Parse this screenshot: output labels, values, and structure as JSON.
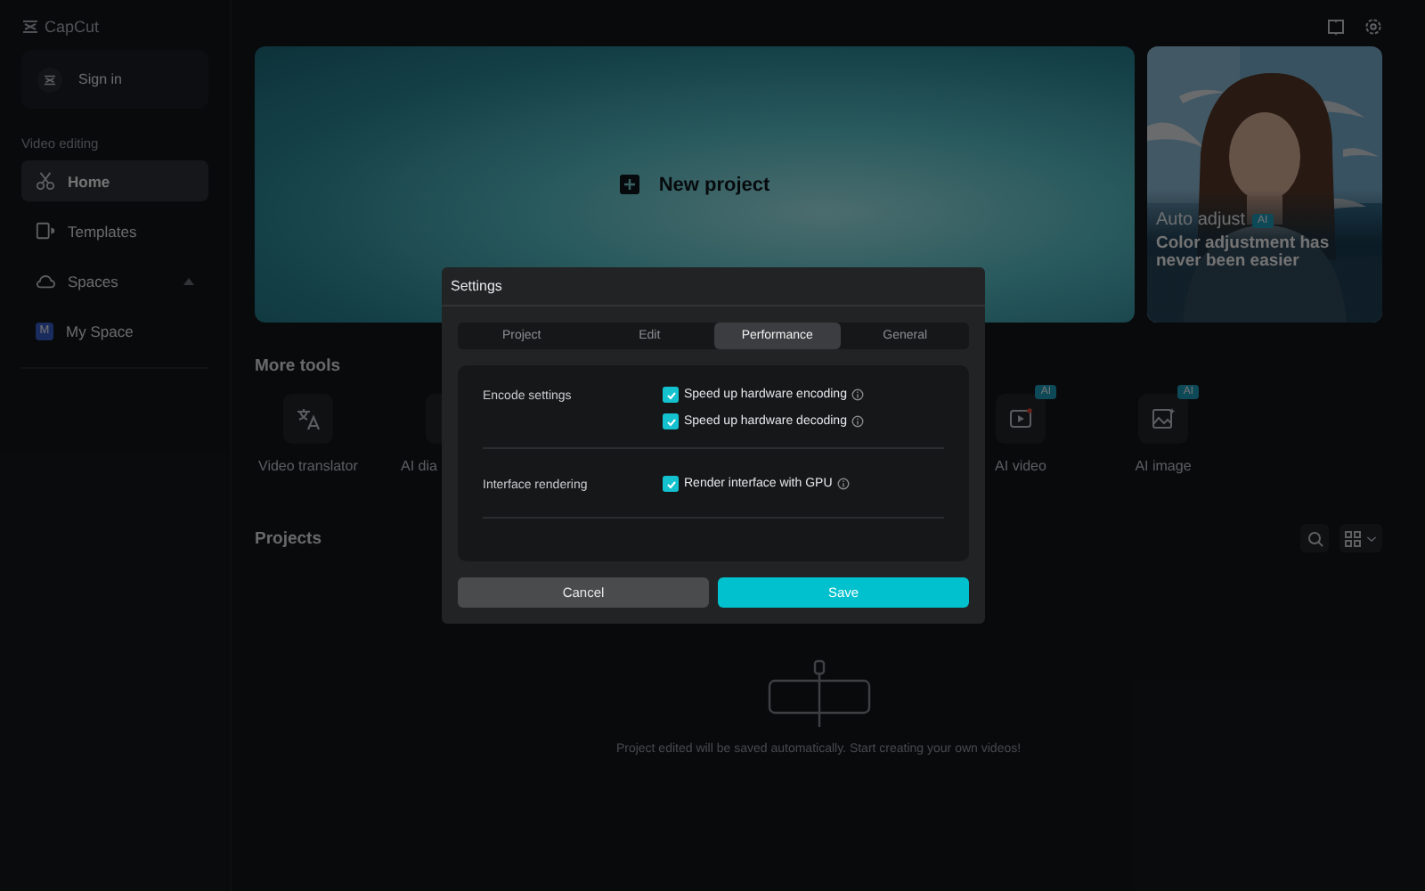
{
  "app": {
    "name": "CapCut"
  },
  "sidebar": {
    "sign_in": "Sign in",
    "section": "Video editing",
    "items": [
      {
        "label": "Home",
        "selected": true
      },
      {
        "label": "Templates",
        "selected": false
      },
      {
        "label": "Spaces",
        "selected": false,
        "expanded": true,
        "children": [
          {
            "label": "My Space",
            "initial": "M",
            "selected": false
          }
        ]
      }
    ]
  },
  "hero": {
    "new_project": "New project"
  },
  "promo": {
    "title": "Auto adjust",
    "badge": "AI",
    "subtitle": "Color adjustment has never been easier"
  },
  "more_tools": {
    "title": "More tools",
    "tools": [
      {
        "label": "Video translator"
      },
      {
        "label": "AI dia"
      },
      {
        "label": "AI video",
        "badge": "AI"
      },
      {
        "label": "AI image",
        "badge": "AI"
      }
    ]
  },
  "projects": {
    "title": "Projects",
    "empty_text": "Project edited will be saved automatically. Start creating your own videos!"
  },
  "dialog": {
    "title": "Settings",
    "tabs": [
      {
        "label": "Project",
        "selected": false
      },
      {
        "label": "Edit",
        "selected": false
      },
      {
        "label": "Performance",
        "selected": true
      },
      {
        "label": "General",
        "selected": false
      }
    ],
    "sections": [
      {
        "label": "Encode settings",
        "options": [
          {
            "label": "Speed up hardware encoding",
            "checked": true
          },
          {
            "label": "Speed up hardware decoding",
            "checked": true
          }
        ]
      },
      {
        "label": "Interface rendering",
        "options": [
          {
            "label": "Render interface with GPU",
            "checked": true
          }
        ]
      }
    ],
    "buttons": [
      {
        "label": "Cancel",
        "kind": "secondary"
      },
      {
        "label": "Save",
        "kind": "primary"
      }
    ]
  }
}
